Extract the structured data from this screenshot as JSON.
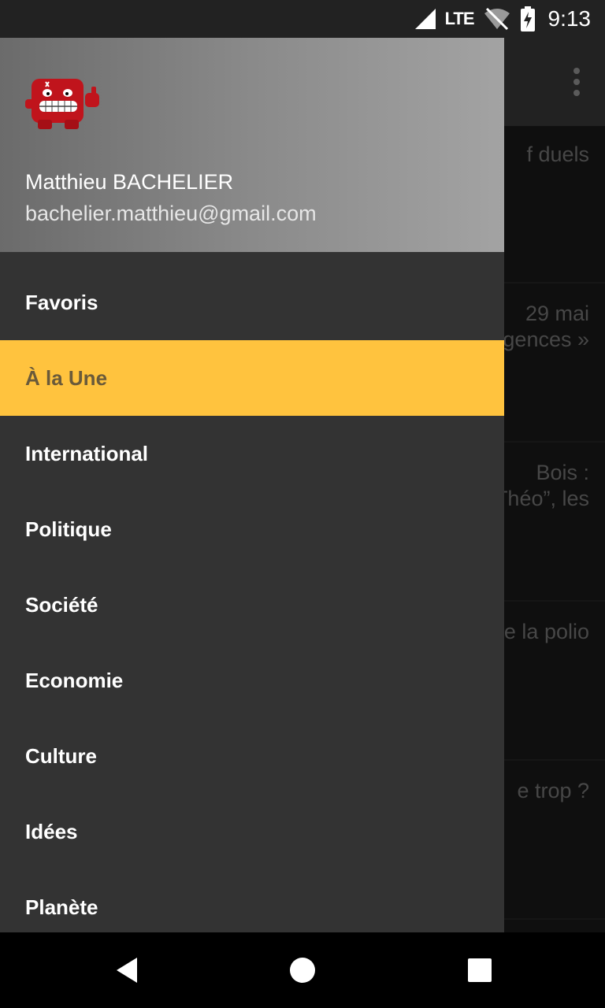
{
  "status_bar": {
    "network": "LTE",
    "time": "9:13",
    "icons": [
      "signal-icon",
      "wifi-off-icon",
      "battery-charging-icon"
    ]
  },
  "background_list": {
    "items": [
      {
        "lines": [
          "f duels"
        ]
      },
      {
        "lines": [
          "29 mai",
          "gences »"
        ]
      },
      {
        "lines": [
          "Bois :",
          "Théo”, les"
        ]
      },
      {
        "lines": [
          "e la polio"
        ]
      },
      {
        "lines": [
          "e trop ?"
        ]
      }
    ]
  },
  "drawer": {
    "user_name": "Matthieu BACHELIER",
    "user_email": "bachelier.matthieu@gmail.com",
    "items": [
      {
        "label": "Favoris",
        "active": false
      },
      {
        "label": "À la Une",
        "active": true
      },
      {
        "label": "International",
        "active": false
      },
      {
        "label": "Politique",
        "active": false
      },
      {
        "label": "Société",
        "active": false
      },
      {
        "label": "Economie",
        "active": false
      },
      {
        "label": "Culture",
        "active": false
      },
      {
        "label": "Idées",
        "active": false
      },
      {
        "label": "Planète",
        "active": false
      }
    ],
    "accent_color": "#ffc33e"
  },
  "nav_bar": {
    "buttons": [
      "back-icon",
      "home-icon",
      "recents-icon"
    ]
  }
}
